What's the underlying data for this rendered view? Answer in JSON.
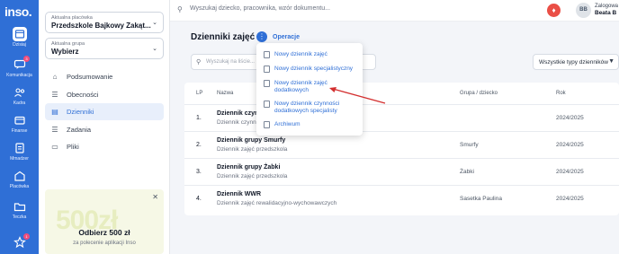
{
  "app": {
    "logo": "inso."
  },
  "rail": {
    "items": [
      {
        "label": "Dzisiaj",
        "icon": "calendar-icon"
      },
      {
        "label": "Komunikacja",
        "icon": "chat-icon",
        "badge": "3"
      },
      {
        "label": "Kadra",
        "icon": "people-icon"
      },
      {
        "label": "Finanse",
        "icon": "wallet-icon"
      },
      {
        "label": "Mmadzer",
        "icon": "document-icon"
      },
      {
        "label": "Placówka",
        "icon": "building-icon"
      },
      {
        "label": "Teczka",
        "icon": "folder-icon"
      },
      {
        "label": "",
        "icon": "star-icon",
        "badge": "1"
      }
    ]
  },
  "sidebar": {
    "facility": {
      "caption": "Aktualna placówka",
      "value": "Przedszkole Bajkowy Zakąt..."
    },
    "group": {
      "caption": "Aktualna grupa",
      "value": "Wybierz"
    },
    "nav": [
      {
        "label": "Podsumowanie",
        "icon": "home-icon"
      },
      {
        "label": "Obecności",
        "icon": "list-icon"
      },
      {
        "label": "Dzienniki",
        "icon": "book-icon",
        "active": true
      },
      {
        "label": "Zadania",
        "icon": "tasks-icon"
      },
      {
        "label": "Pliki",
        "icon": "folder-icon"
      }
    ],
    "promo": {
      "big": "500zł",
      "title": "Odbierz 500 zł",
      "subtitle": "za polecenie aplikacji Inso"
    }
  },
  "topbar": {
    "search_placeholder": "Wyszukaj dziecko, pracownika, wzór dokumentu...",
    "avatar": "BB",
    "user_caption": "Zalogowa",
    "user_name": "Beata B"
  },
  "main": {
    "title": "Dzienniki zajęć",
    "operations_label": "Operacje",
    "search_placeholder": "Wyszukaj na liście...",
    "type_filter": "Wszystkie typy dzienników",
    "columns": {
      "lp": "LP",
      "name": "Nazwa",
      "group": "Grupa / dziecko",
      "year": "Rok"
    },
    "rows": [
      {
        "lp": "1.",
        "name": "Dziennik czynn",
        "desc": "Dziennik czynn",
        "group": "",
        "year": "2024/2025"
      },
      {
        "lp": "2.",
        "name": "Dziennik grupy Smurfy",
        "desc": "Dziennik zajęć przedszkola",
        "group": "Smurfy",
        "year": "2024/2025"
      },
      {
        "lp": "3.",
        "name": "Dziennik grupy Żabki",
        "desc": "Dziennik zajęć przedszkola",
        "group": "Żabki",
        "year": "2024/2025"
      },
      {
        "lp": "4.",
        "name": "Dziennik WWR",
        "desc": "Dziennik zajęć rewalidacyjno-wychowawczych",
        "group": "Sasetka Paulina",
        "year": "2024/2025"
      }
    ]
  },
  "menu": {
    "items": [
      {
        "label": "Nowy dziennik zajęć"
      },
      {
        "label": "Nowy dziennik specjalistyczny"
      },
      {
        "label": "Nowy dziennik zajęć dodatkowych"
      },
      {
        "label": "Nowy dziennik czynności dodatkowych specjalisty"
      },
      {
        "label": "Archiwum"
      }
    ]
  },
  "colors": {
    "accent": "#2f6fd6",
    "alert": "#ea4f46",
    "annotation": "#d32f2f"
  }
}
